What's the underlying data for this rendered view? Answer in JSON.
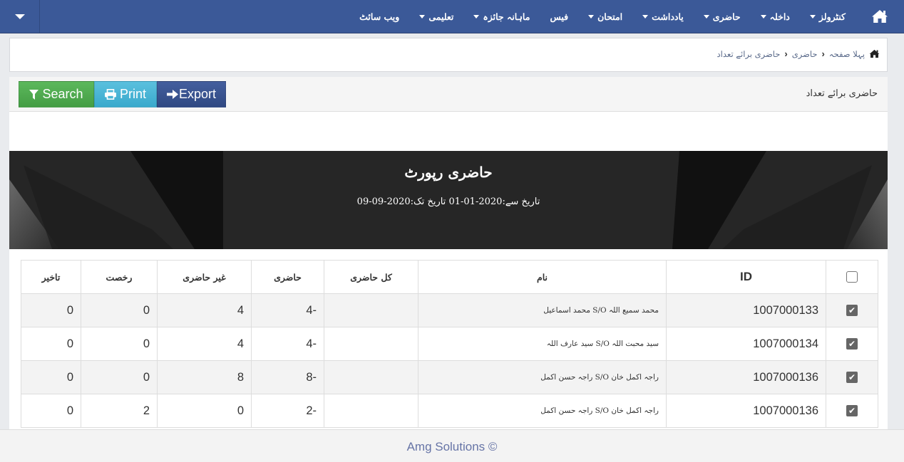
{
  "navbar": {
    "home_icon": "home-icon",
    "items": [
      {
        "label": "کنٹرولز",
        "dropdown": true
      },
      {
        "label": "داخلہ",
        "dropdown": true
      },
      {
        "label": "حاضری",
        "dropdown": true
      },
      {
        "label": "یادداشت",
        "dropdown": true
      },
      {
        "label": "امتحان",
        "dropdown": true
      },
      {
        "label": "فیس",
        "dropdown": false
      },
      {
        "label": "ماہانہ جائزہ",
        "dropdown": true
      },
      {
        "label": "تعلیمی",
        "dropdown": true
      },
      {
        "label": "ویب سائٹ",
        "dropdown": false
      }
    ],
    "left_toggle_icon": "caret-down-icon",
    "color": "#3b5998"
  },
  "breadcrumb": {
    "home_icon": "home-icon",
    "items": [
      "پہلا صفحہ",
      "حاضری",
      "حاضری برائے تعداد"
    ]
  },
  "panel": {
    "title": "حاضری برائے تعداد",
    "buttons": {
      "search": "Search",
      "print": "Print",
      "export": "Export"
    },
    "button_colors": {
      "search": "#5cb85c",
      "print": "#5bc0de",
      "export": "#3b5998"
    }
  },
  "report": {
    "title": "حاضری رپورٹ",
    "date_range": "تاریخ سے:2020-01-01 تاریخ تک:2020-09-09"
  },
  "table": {
    "headers": {
      "select": "",
      "id": "ID",
      "name": "نام",
      "total": "کل حاضری",
      "present": "حاضری",
      "absent": "غیر حاضری",
      "leave": "رخصت",
      "late": "تاخیر"
    },
    "select_all_checked": false,
    "rows": [
      {
        "checked": true,
        "id": "1007000133",
        "name": "محمد اسماعیل S/O محمد سمیع اللہ",
        "total": "",
        "present": "4-",
        "absent": "4",
        "leave": "0",
        "late": "0"
      },
      {
        "checked": true,
        "id": "1007000134",
        "name": "سید عارف اللہ S/O سید محبت اللہ",
        "total": "",
        "present": "4-",
        "absent": "4",
        "leave": "0",
        "late": "0"
      },
      {
        "checked": true,
        "id": "1007000136",
        "name": "راجہ حسن اکمل S/O راجہ اکمل خان",
        "total": "",
        "present": "8-",
        "absent": "8",
        "leave": "0",
        "late": "0"
      },
      {
        "checked": true,
        "id": "1007000136",
        "name": "راجہ حسن اکمل S/O راجہ اکمل خان",
        "total": "",
        "present": "2-",
        "absent": "0",
        "leave": "2",
        "late": "0"
      }
    ]
  },
  "footer": {
    "text": "Amg Solutions ©"
  }
}
